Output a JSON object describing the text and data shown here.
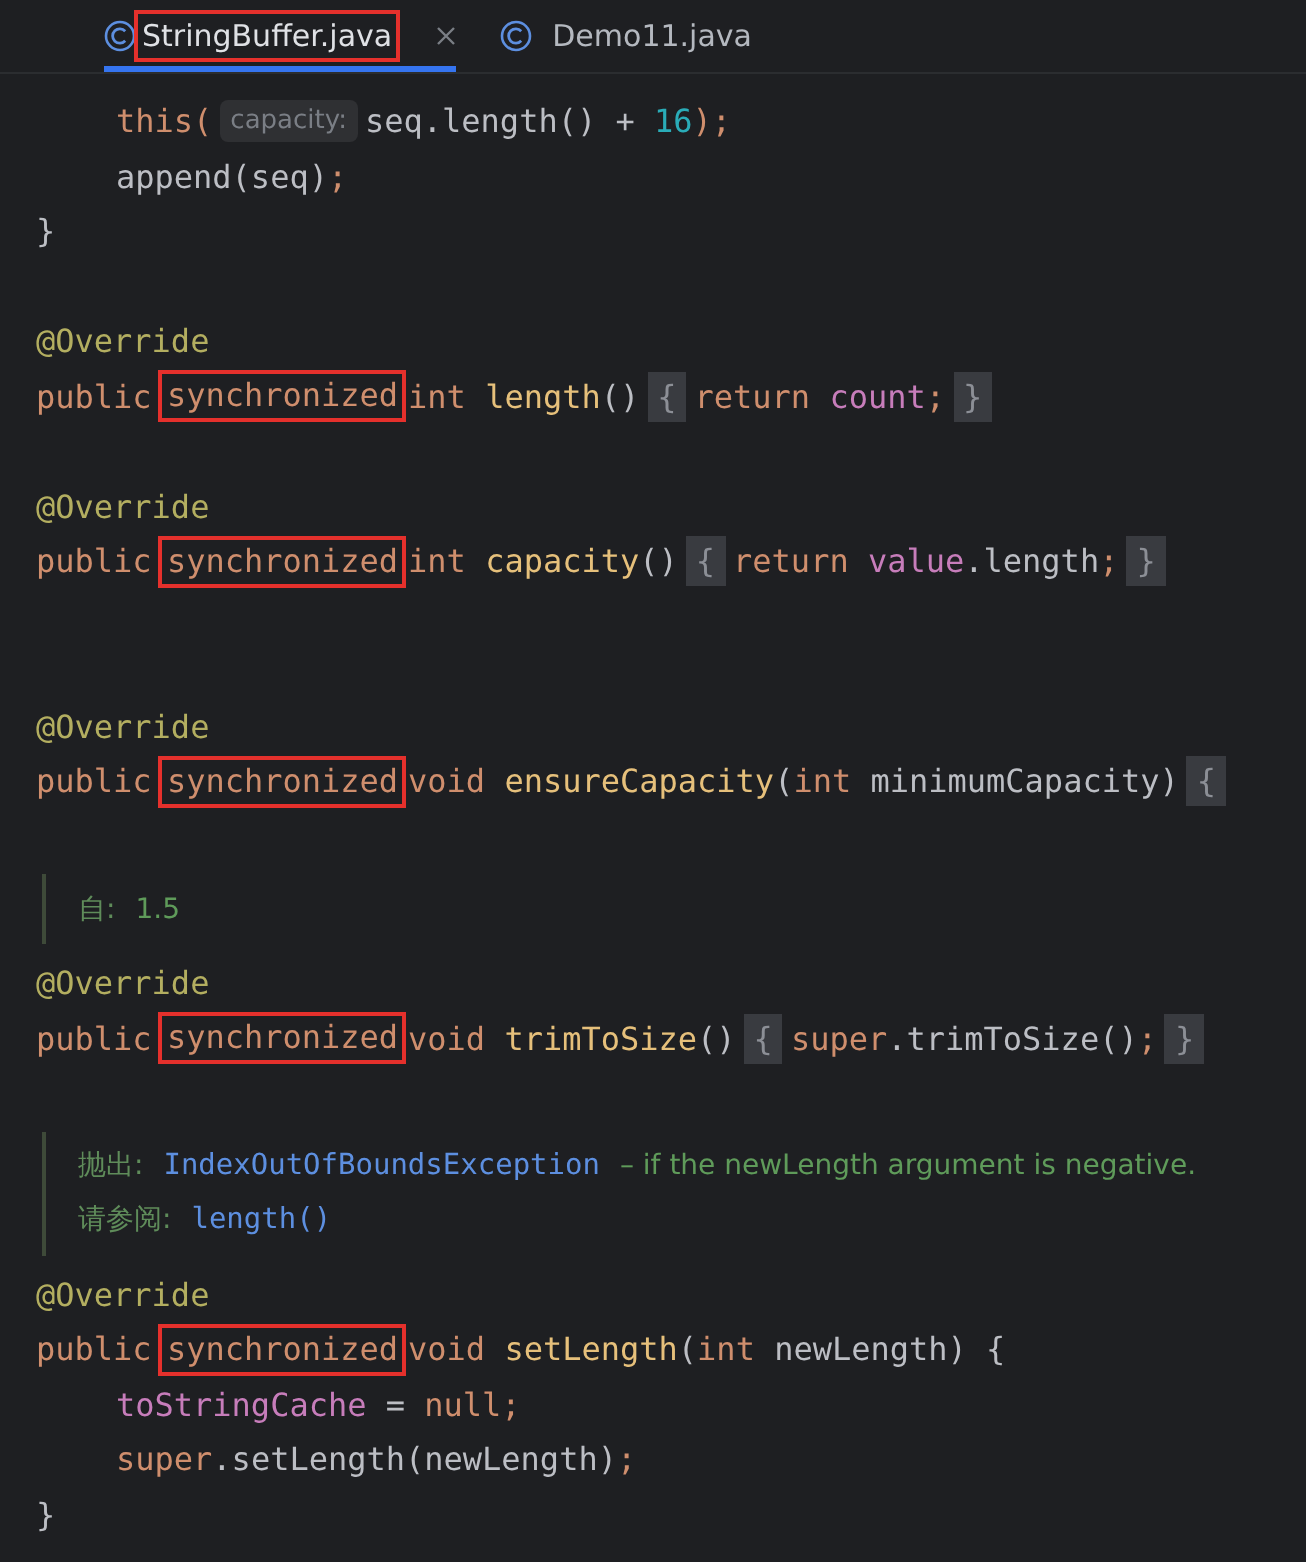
{
  "tabs": [
    {
      "label": "StringBuffer.java",
      "selected": true,
      "highlighted": true,
      "closable": true
    },
    {
      "label": "Demo11.java",
      "selected": false,
      "highlighted": false,
      "closable": false
    }
  ],
  "editor": {
    "lines": [
      {
        "kind": "code",
        "indented": true,
        "tokens": [
          {
            "text": "this(",
            "kind": "kw"
          },
          {
            "text": "capacity:",
            "kind": "hint"
          },
          {
            "text": "seq.length() + ",
            "kind": "plain"
          },
          {
            "text": "16",
            "kind": "num"
          },
          {
            "text": ");",
            "kind": "kw"
          }
        ]
      },
      {
        "kind": "code",
        "indented": true,
        "tokens": [
          {
            "text": "append(seq)",
            "kind": "plain"
          },
          {
            "text": ";",
            "kind": "kw"
          }
        ]
      },
      {
        "kind": "code",
        "indented": false,
        "tokens": [
          {
            "text": "}",
            "kind": "plain"
          }
        ]
      },
      {
        "kind": "blank"
      },
      {
        "kind": "code",
        "indented": false,
        "tokens": [
          {
            "text": "@Override",
            "kind": "ann"
          }
        ]
      },
      {
        "kind": "code",
        "indented": false,
        "tokens": [
          {
            "text": "public ",
            "kind": "kw"
          },
          {
            "text": "synchronized",
            "kind": "kw",
            "boxed": true
          },
          {
            "text": "int ",
            "kind": "kw"
          },
          {
            "text": "length",
            "kind": "fn"
          },
          {
            "text": "()",
            "kind": "plain"
          },
          {
            "text": "{",
            "kind": "fold"
          },
          {
            "text": "return ",
            "kind": "kw"
          },
          {
            "text": "count",
            "kind": "field"
          },
          {
            "text": ";",
            "kind": "kw"
          },
          {
            "text": "}",
            "kind": "fold"
          }
        ]
      },
      {
        "kind": "blank"
      },
      {
        "kind": "code",
        "indented": false,
        "tokens": [
          {
            "text": "@Override",
            "kind": "ann"
          }
        ]
      },
      {
        "kind": "code",
        "indented": false,
        "tokens": [
          {
            "text": "public ",
            "kind": "kw"
          },
          {
            "text": "synchronized",
            "kind": "kw",
            "boxed": true
          },
          {
            "text": "int ",
            "kind": "kw"
          },
          {
            "text": "capacity",
            "kind": "fn"
          },
          {
            "text": "()",
            "kind": "plain"
          },
          {
            "text": "{",
            "kind": "fold"
          },
          {
            "text": "return ",
            "kind": "kw"
          },
          {
            "text": "value",
            "kind": "field"
          },
          {
            "text": ".length",
            "kind": "plain"
          },
          {
            "text": ";",
            "kind": "kw"
          },
          {
            "text": "}",
            "kind": "fold"
          }
        ]
      },
      {
        "kind": "blank"
      },
      {
        "kind": "blank"
      },
      {
        "kind": "code",
        "indented": false,
        "tokens": [
          {
            "text": "@Override",
            "kind": "ann"
          }
        ]
      },
      {
        "kind": "code",
        "indented": false,
        "tokens": [
          {
            "text": "public ",
            "kind": "kw"
          },
          {
            "text": "synchronized",
            "kind": "kw",
            "boxed": true
          },
          {
            "text": "void ",
            "kind": "kw"
          },
          {
            "text": "ensureCapacity",
            "kind": "fn"
          },
          {
            "text": "(",
            "kind": "plain"
          },
          {
            "text": "int ",
            "kind": "kw"
          },
          {
            "text": "minimumCapacity)",
            "kind": "plain"
          },
          {
            "text": "{",
            "kind": "fold"
          }
        ]
      },
      {
        "kind": "blank"
      },
      {
        "kind": "doc",
        "rows": [
          [
            {
              "text": "自: ",
              "kind": "doclabel"
            },
            {
              "text": "1.5",
              "kind": "doc"
            }
          ]
        ]
      },
      {
        "kind": "code",
        "indented": false,
        "tokens": [
          {
            "text": "@Override",
            "kind": "ann"
          }
        ]
      },
      {
        "kind": "code",
        "indented": false,
        "tokens": [
          {
            "text": "public ",
            "kind": "kw"
          },
          {
            "text": "synchronized",
            "kind": "kw",
            "boxed": true
          },
          {
            "text": "void ",
            "kind": "kw"
          },
          {
            "text": "trimToSize",
            "kind": "fn"
          },
          {
            "text": "()",
            "kind": "plain"
          },
          {
            "text": "{",
            "kind": "fold"
          },
          {
            "text": "super",
            "kind": "kw"
          },
          {
            "text": ".trimToSize()",
            "kind": "plain"
          },
          {
            "text": ";",
            "kind": "kw"
          },
          {
            "text": "}",
            "kind": "fold"
          }
        ]
      },
      {
        "kind": "blank"
      },
      {
        "kind": "doc",
        "rows": [
          [
            {
              "text": "抛出:",
              "kind": "doclabel"
            },
            {
              "text": "IndexOutOfBoundsException",
              "kind": "doclink"
            },
            {
              "text": "– if the newLength argument is negative.",
              "kind": "doc"
            }
          ],
          [
            {
              "text": "请参阅:",
              "kind": "doclabel"
            },
            {
              "text": "length()",
              "kind": "doclink"
            }
          ]
        ]
      },
      {
        "kind": "code",
        "indented": false,
        "tokens": [
          {
            "text": "@Override",
            "kind": "ann"
          }
        ]
      },
      {
        "kind": "code",
        "indented": false,
        "tokens": [
          {
            "text": "public ",
            "kind": "kw"
          },
          {
            "text": "synchronized",
            "kind": "kw",
            "boxed": true
          },
          {
            "text": "void ",
            "kind": "kw"
          },
          {
            "text": "setLength",
            "kind": "fn"
          },
          {
            "text": "(",
            "kind": "plain"
          },
          {
            "text": "int ",
            "kind": "kw"
          },
          {
            "text": "newLength) {",
            "kind": "plain"
          }
        ]
      },
      {
        "kind": "code",
        "indented": true,
        "tokens": [
          {
            "text": "toStringCache",
            "kind": "field"
          },
          {
            "text": " = ",
            "kind": "plain"
          },
          {
            "text": "null;",
            "kind": "kw"
          }
        ]
      },
      {
        "kind": "code",
        "indented": true,
        "tokens": [
          {
            "text": "super",
            "kind": "kw"
          },
          {
            "text": ".setLength(newLength)",
            "kind": "plain"
          },
          {
            "text": ";",
            "kind": "kw"
          }
        ]
      },
      {
        "kind": "code",
        "indented": false,
        "tokens": [
          {
            "text": "}",
            "kind": "plain"
          }
        ]
      }
    ]
  }
}
